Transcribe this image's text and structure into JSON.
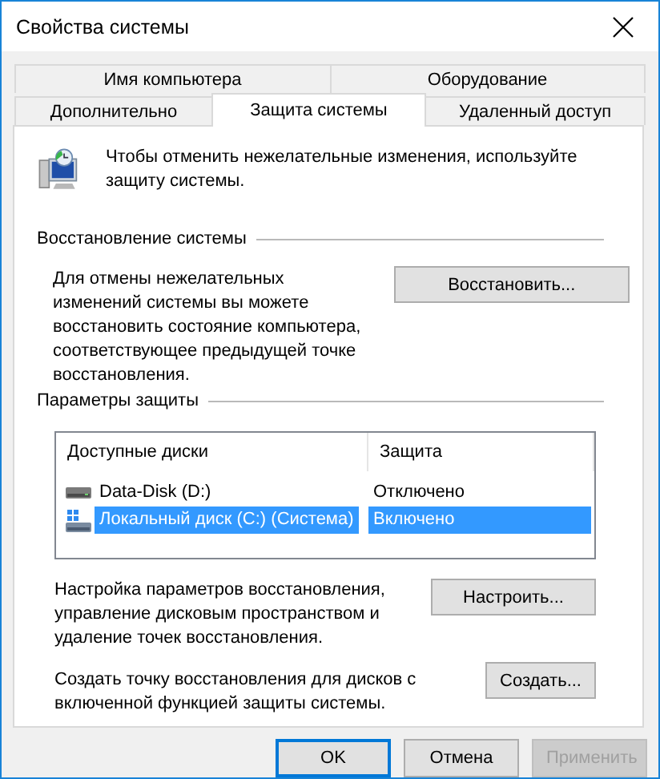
{
  "window": {
    "title": "Свойства системы"
  },
  "tab_rows": [
    [
      {
        "label": "Имя компьютера",
        "selected": false
      },
      {
        "label": "Оборудование",
        "selected": false
      }
    ],
    [
      {
        "label": "Дополнительно",
        "selected": false
      },
      {
        "label": "Защита системы",
        "selected": true
      },
      {
        "label": "Удаленный доступ",
        "selected": false
      }
    ]
  ],
  "intro": "Чтобы отменить нежелательные изменения, используйте защиту системы.",
  "restore_group": {
    "title": "Восстановление системы",
    "text": "Для отмены нежелательных изменений системы вы можете восстановить состояние компьютера, соответствующее предыдущей точке восстановления.",
    "button": "Восстановить..."
  },
  "protection_group": {
    "title": "Параметры защиты",
    "columns": [
      "Доступные диски",
      "Защита"
    ],
    "disks": [
      {
        "name": "Data-Disk (D:)",
        "protection": "Отключено",
        "kind": "data",
        "selected": false
      },
      {
        "name": "Локальный диск (C:) (Система)",
        "protection": "Включено",
        "kind": "system",
        "selected": true
      }
    ],
    "configure_text": "Настройка параметров восстановления, управление дисковым пространством и удаление точек восстановления.",
    "configure_button": "Настроить...",
    "create_text": "Создать точку восстановления для дисков с включенной функцией защиты системы.",
    "create_button": "Создать..."
  },
  "buttons": [
    {
      "label": "OK",
      "default": true,
      "disabled": false
    },
    {
      "label": "Отмена",
      "default": false,
      "disabled": false
    },
    {
      "label": "Применить",
      "default": false,
      "disabled": true
    }
  ]
}
